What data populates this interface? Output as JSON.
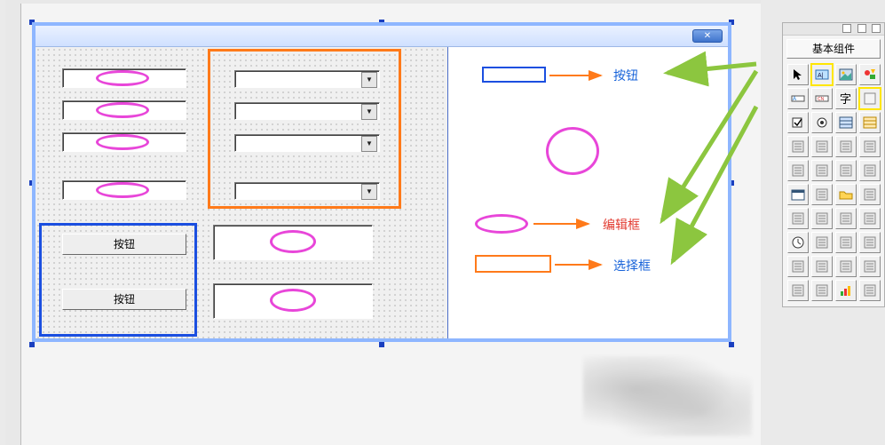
{
  "palette": {
    "header": "基本组件",
    "tools": [
      "pointer-icon",
      "label-icon",
      "image-icon",
      "shapes-icon",
      "textfield-icon",
      "cn-icon",
      "font-icon",
      "panel-icon",
      "checkbox-icon",
      "radio-icon",
      "list-icon",
      "list2-icon",
      "grid-icon",
      "table-icon",
      "box-icon",
      "color-icon",
      "baseline-icon",
      "line-icon",
      "frame-icon",
      "window-icon",
      "calendar-icon",
      "button-icon",
      "folder-icon",
      "page-icon",
      "palette-icon",
      "net-icon",
      "sizer-icon",
      "columns-icon",
      "clock-icon",
      "rec-icon",
      "link1-icon",
      "link2-icon",
      "hier-icon",
      "conn-icon",
      "grid2-icon",
      "bind-icon",
      "btn1-icon",
      "btn2-icon",
      "chart-icon",
      "db-icon"
    ],
    "highlight_label": 1,
    "highlight_panel": 7
  },
  "form_left_buttons": {
    "btn1": "按钮",
    "btn2": "按钮"
  },
  "legend": {
    "button": "按钮",
    "edit": "编辑框",
    "select": "选择框"
  },
  "close_glyph": "✕"
}
